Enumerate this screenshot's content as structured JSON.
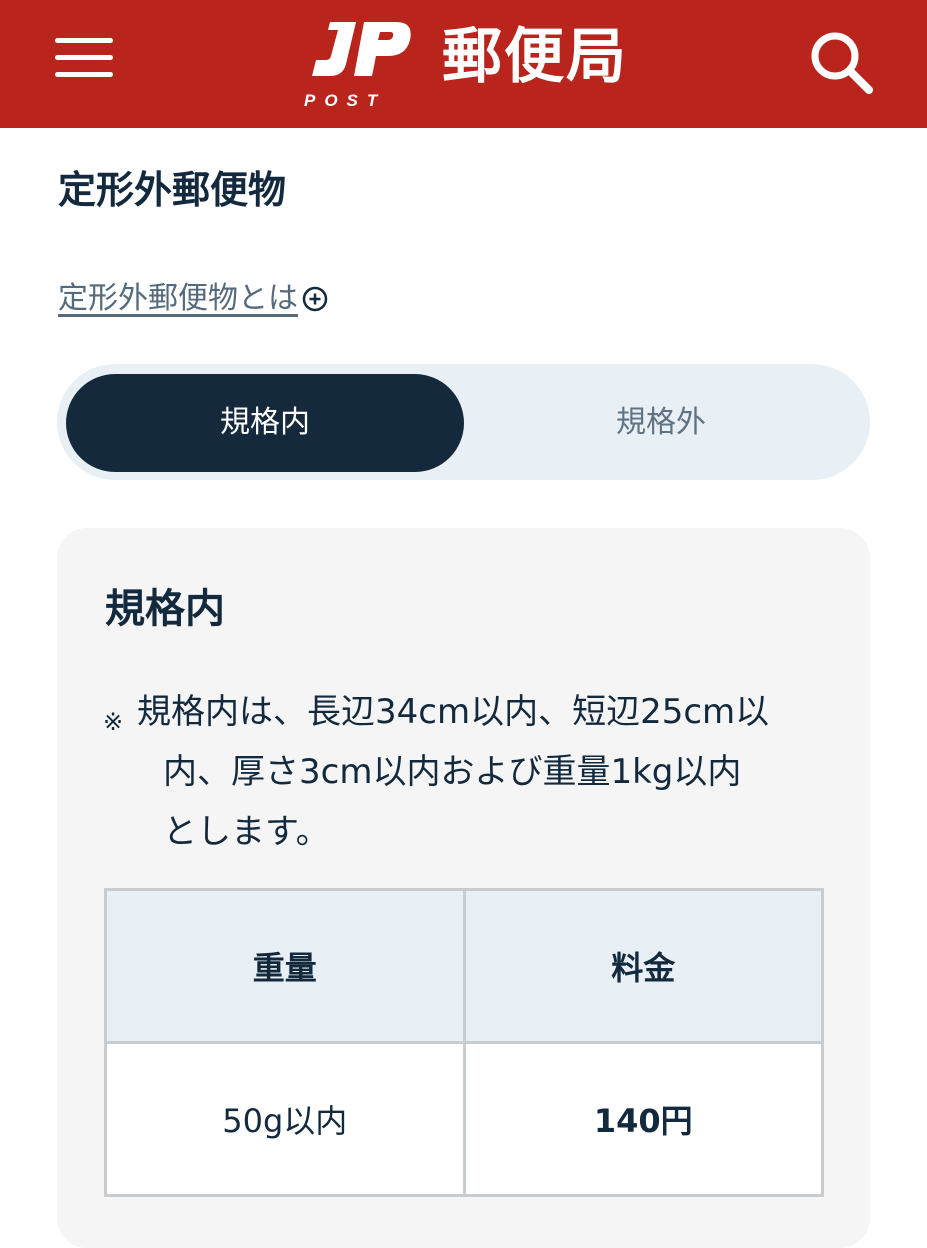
{
  "header": {
    "logo_mark": "JP",
    "logo_post": "POST",
    "site_title": "郵便局",
    "menu_icon": "hamburger-menu-icon",
    "search_icon": "search-icon",
    "background_color": "#b9241c"
  },
  "page": {
    "title": "定形外郵便物",
    "about_link": "定形外郵便物とは",
    "about_link_icon": "plus-circle-icon"
  },
  "tabs": {
    "active": "規格内",
    "inactive": "規格外",
    "active_color": "#14293b"
  },
  "card": {
    "title": "規格内",
    "note_mark": "※",
    "note_lines": [
      "規格内は、長辺34cm以内、短辺25cm以",
      "内、厚さ3cm以内および重量1kg以内",
      "とします。"
    ],
    "table": {
      "headers": [
        "重量",
        "料金"
      ],
      "rows": [
        {
          "weight": "50g以内",
          "price": "140円"
        }
      ]
    }
  }
}
